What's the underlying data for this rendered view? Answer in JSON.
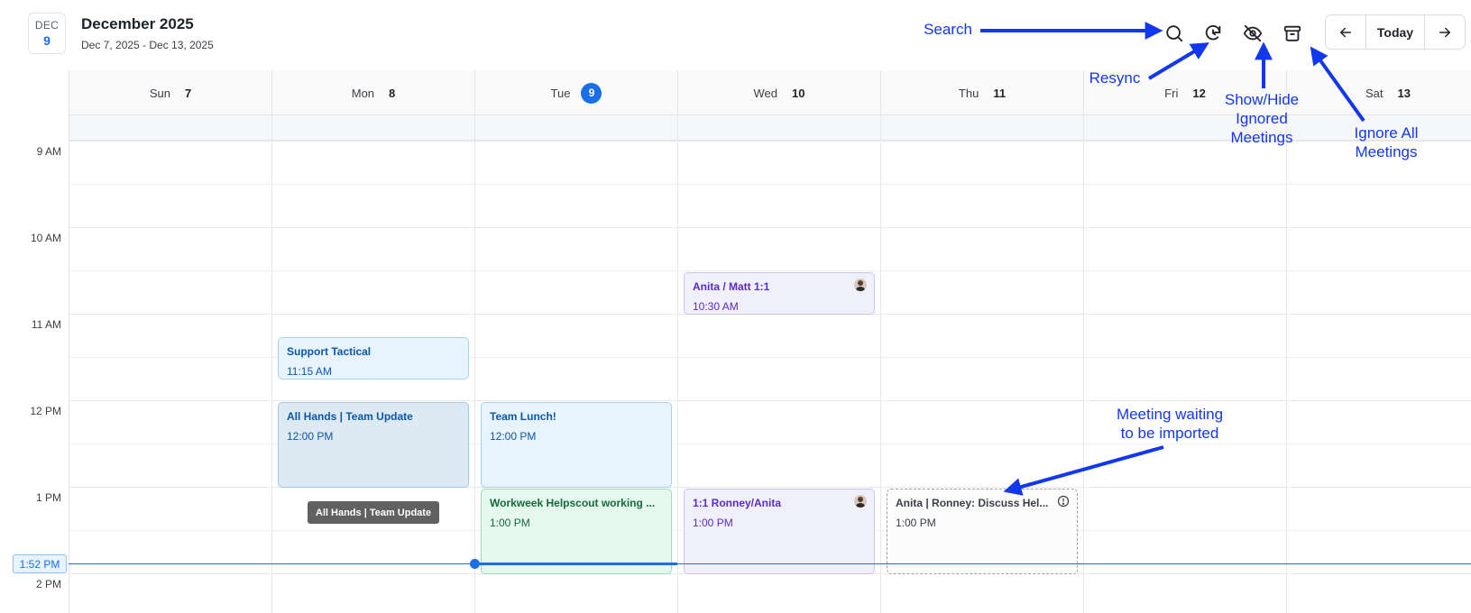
{
  "header": {
    "badge_month": "DEC",
    "badge_day": "9",
    "title": "December 2025",
    "range": "Dec 7, 2025 - Dec 13, 2025"
  },
  "toolbar": {
    "search_icon": "search-icon",
    "resync_icon": "resync-icon",
    "hide_icon": "eye-off-icon",
    "archive_icon": "archive-icon",
    "prev_icon": "arrow-left-icon",
    "today_label": "Today",
    "next_icon": "arrow-right-icon"
  },
  "days": [
    {
      "name": "Sun",
      "num": "7"
    },
    {
      "name": "Mon",
      "num": "8"
    },
    {
      "name": "Tue",
      "num": "9",
      "today": true
    },
    {
      "name": "Wed",
      "num": "10"
    },
    {
      "name": "Thu",
      "num": "11"
    },
    {
      "name": "Fri",
      "num": "12"
    },
    {
      "name": "Sat",
      "num": "13"
    }
  ],
  "hours": [
    "9 AM",
    "10 AM",
    "11 AM",
    "12 PM",
    "1 PM",
    "2 PM"
  ],
  "events": {
    "anita_matt": {
      "title": "Anita / Matt 1:1",
      "time": "10:30 AM"
    },
    "support_tactical": {
      "title": "Support Tactical",
      "time": "11:15 AM"
    },
    "all_hands": {
      "title": "All Hands | Team Update",
      "time": "12:00 PM"
    },
    "team_lunch": {
      "title": "Team Lunch!",
      "time": "12:00 PM"
    },
    "workweek": {
      "title": "Workweek Helpscout working ...",
      "time": "1:00 PM"
    },
    "ronney_anita": {
      "title": "1:1 Ronney/Anita",
      "time": "1:00 PM"
    },
    "discuss": {
      "title": "Anita | Ronney: Discuss Hel...",
      "time": "1:00 PM"
    }
  },
  "tooltip": "All Hands | Team Update",
  "now_label": "1:52 PM",
  "annotations": {
    "search": "Search",
    "resync": "Resync",
    "show_hide": "Show/Hide\nIgnored\nMeetings",
    "ignore_all": "Ignore All\nMeetings",
    "waiting": "Meeting waiting\nto be imported"
  },
  "colors": {
    "accent": "#1a6fe8",
    "annotation": "#1238ef"
  }
}
